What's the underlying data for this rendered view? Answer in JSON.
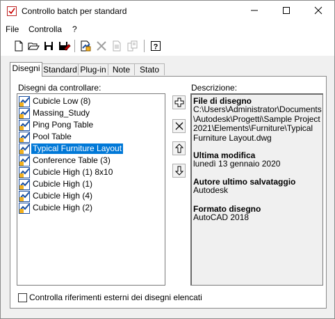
{
  "window": {
    "title": "Controllo batch per standard"
  },
  "menu": [
    "File",
    "Controlla",
    "?"
  ],
  "toolbar": {
    "buttons": [
      "new-icon",
      "open-icon",
      "save-icon",
      "save-as-icon",
      "add-drawing-icon",
      "remove-icon",
      "move-up-doc-icon",
      "move-down-doc-icon",
      "help-icon"
    ],
    "help_glyph": "?"
  },
  "tabs": [
    "Disegni",
    "Standard",
    "Plug-in",
    "Note",
    "Stato"
  ],
  "drawings": {
    "label": "Disegni da controllare:",
    "items": [
      "Cubicle Low (8)",
      "Massing_Study",
      "Ping Pong Table",
      "Pool Table",
      "Typical Furniture Layout",
      "Conference Table (3)",
      "Cubicle High (1) 8x10",
      "Cubicle High (1)",
      "Cubicle High (4)",
      "Cubicle High (2)"
    ],
    "selected_index": 4
  },
  "description": {
    "label": "Descrizione:",
    "file_heading": "File di disegno",
    "file_lines": [
      "C:\\Users\\Administrator\\Documents",
      "\\Autodesk\\Progetti\\Sample Project",
      "2021\\Elements\\Furniture\\Typical",
      "Furniture Layout.dwg"
    ],
    "modified_heading": "Ultima modifica",
    "modified_value": "lunedì 13 gennaio 2020",
    "author_heading": "Autore ultimo salvataggio",
    "author_value": "Autodesk",
    "format_heading": "Formato disegno",
    "format_value": "AutoCAD 2018"
  },
  "checkbox": {
    "label": "Controlla riferimenti esterni dei disegni elencati",
    "checked": false
  }
}
